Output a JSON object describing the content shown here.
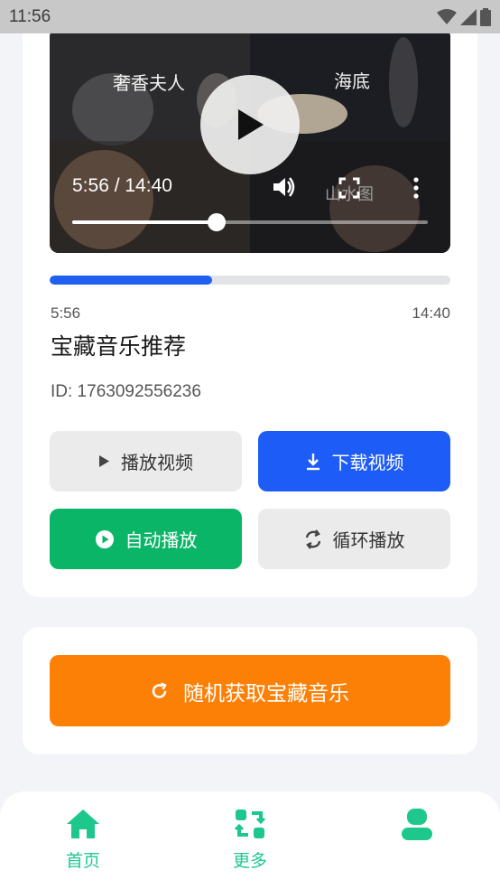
{
  "status_bar": {
    "time": "11:56"
  },
  "player": {
    "current_time": "5:56",
    "total_time": "14:40",
    "time_label": "5:56 / 14:40",
    "progress_fraction": 0.405,
    "thumbnail_captions": [
      "奢香夫人",
      "海底",
      "山水图"
    ]
  },
  "song": {
    "title": "宝藏音乐推荐",
    "id_text": "ID: 1763092556236"
  },
  "buttons": {
    "play_video": "播放视频",
    "download_video": "下载视频",
    "autoplay": "自动播放",
    "loop_play": "循环播放",
    "random_fetch": "随机获取宝藏音乐"
  },
  "nav": {
    "home": "首页",
    "more": "更多",
    "profile": ""
  },
  "colors": {
    "blue": "#1e5cf8",
    "green": "#0bb568",
    "orange": "#fd8006",
    "nav_accent": "#1ec88c"
  }
}
